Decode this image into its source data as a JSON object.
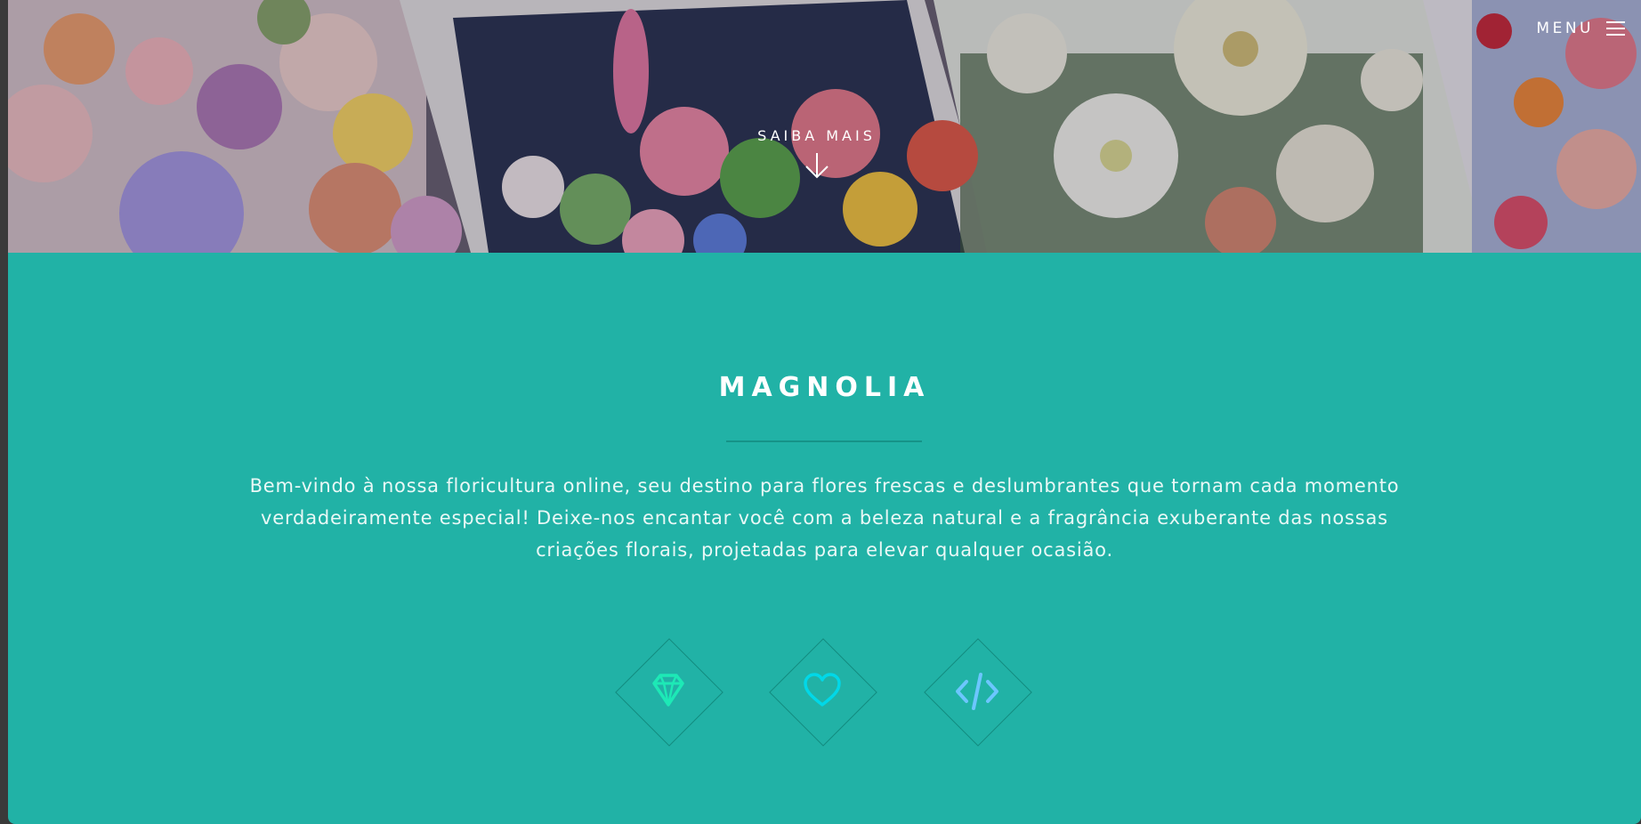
{
  "header": {
    "menu_label": "MENU",
    "menu_icon": "hamburger-icon"
  },
  "hero": {
    "cta_label": "SAIBA MAIS",
    "cta_icon": "arrow-down-icon"
  },
  "intro": {
    "title": "MAGNOLIA",
    "description": "Bem-vindo à nossa floricultura online, seu destino para flores frescas e deslumbrantes que tornam cada momento verdadeiramente especial! Deixe-nos encantar você com a beleza natural e a fragrância exuberante das nossas criações florais, projetadas para elevar qualquer ocasião."
  },
  "features": [
    {
      "icon": "diamond-icon",
      "color": "#1de9b6"
    },
    {
      "icon": "heart-icon",
      "color": "#00d8e8"
    },
    {
      "icon": "code-icon",
      "color": "#6cc6ff"
    }
  ],
  "colors": {
    "section_background": "#21b2a6",
    "text": "#ffffff"
  }
}
